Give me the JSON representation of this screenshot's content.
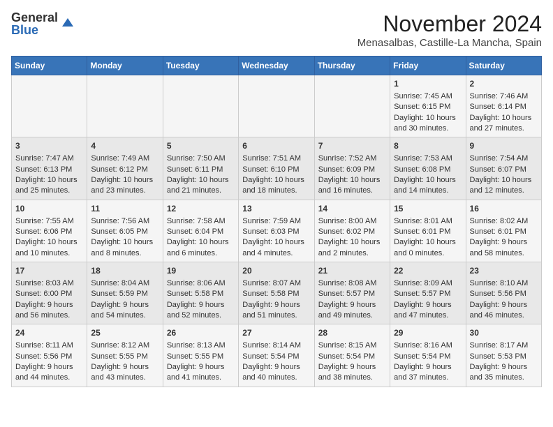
{
  "header": {
    "logo_line1": "General",
    "logo_line2": "Blue",
    "title": "November 2024",
    "subtitle": "Menasalbas, Castille-La Mancha, Spain"
  },
  "days_of_week": [
    "Sunday",
    "Monday",
    "Tuesday",
    "Wednesday",
    "Thursday",
    "Friday",
    "Saturday"
  ],
  "weeks": [
    [
      {
        "day": "",
        "info": ""
      },
      {
        "day": "",
        "info": ""
      },
      {
        "day": "",
        "info": ""
      },
      {
        "day": "",
        "info": ""
      },
      {
        "day": "",
        "info": ""
      },
      {
        "day": "1",
        "info": "Sunrise: 7:45 AM\nSunset: 6:15 PM\nDaylight: 10 hours and 30 minutes."
      },
      {
        "day": "2",
        "info": "Sunrise: 7:46 AM\nSunset: 6:14 PM\nDaylight: 10 hours and 27 minutes."
      }
    ],
    [
      {
        "day": "3",
        "info": "Sunrise: 7:47 AM\nSunset: 6:13 PM\nDaylight: 10 hours and 25 minutes."
      },
      {
        "day": "4",
        "info": "Sunrise: 7:49 AM\nSunset: 6:12 PM\nDaylight: 10 hours and 23 minutes."
      },
      {
        "day": "5",
        "info": "Sunrise: 7:50 AM\nSunset: 6:11 PM\nDaylight: 10 hours and 21 minutes."
      },
      {
        "day": "6",
        "info": "Sunrise: 7:51 AM\nSunset: 6:10 PM\nDaylight: 10 hours and 18 minutes."
      },
      {
        "day": "7",
        "info": "Sunrise: 7:52 AM\nSunset: 6:09 PM\nDaylight: 10 hours and 16 minutes."
      },
      {
        "day": "8",
        "info": "Sunrise: 7:53 AM\nSunset: 6:08 PM\nDaylight: 10 hours and 14 minutes."
      },
      {
        "day": "9",
        "info": "Sunrise: 7:54 AM\nSunset: 6:07 PM\nDaylight: 10 hours and 12 minutes."
      }
    ],
    [
      {
        "day": "10",
        "info": "Sunrise: 7:55 AM\nSunset: 6:06 PM\nDaylight: 10 hours and 10 minutes."
      },
      {
        "day": "11",
        "info": "Sunrise: 7:56 AM\nSunset: 6:05 PM\nDaylight: 10 hours and 8 minutes."
      },
      {
        "day": "12",
        "info": "Sunrise: 7:58 AM\nSunset: 6:04 PM\nDaylight: 10 hours and 6 minutes."
      },
      {
        "day": "13",
        "info": "Sunrise: 7:59 AM\nSunset: 6:03 PM\nDaylight: 10 hours and 4 minutes."
      },
      {
        "day": "14",
        "info": "Sunrise: 8:00 AM\nSunset: 6:02 PM\nDaylight: 10 hours and 2 minutes."
      },
      {
        "day": "15",
        "info": "Sunrise: 8:01 AM\nSunset: 6:01 PM\nDaylight: 10 hours and 0 minutes."
      },
      {
        "day": "16",
        "info": "Sunrise: 8:02 AM\nSunset: 6:01 PM\nDaylight: 9 hours and 58 minutes."
      }
    ],
    [
      {
        "day": "17",
        "info": "Sunrise: 8:03 AM\nSunset: 6:00 PM\nDaylight: 9 hours and 56 minutes."
      },
      {
        "day": "18",
        "info": "Sunrise: 8:04 AM\nSunset: 5:59 PM\nDaylight: 9 hours and 54 minutes."
      },
      {
        "day": "19",
        "info": "Sunrise: 8:06 AM\nSunset: 5:58 PM\nDaylight: 9 hours and 52 minutes."
      },
      {
        "day": "20",
        "info": "Sunrise: 8:07 AM\nSunset: 5:58 PM\nDaylight: 9 hours and 51 minutes."
      },
      {
        "day": "21",
        "info": "Sunrise: 8:08 AM\nSunset: 5:57 PM\nDaylight: 9 hours and 49 minutes."
      },
      {
        "day": "22",
        "info": "Sunrise: 8:09 AM\nSunset: 5:57 PM\nDaylight: 9 hours and 47 minutes."
      },
      {
        "day": "23",
        "info": "Sunrise: 8:10 AM\nSunset: 5:56 PM\nDaylight: 9 hours and 46 minutes."
      }
    ],
    [
      {
        "day": "24",
        "info": "Sunrise: 8:11 AM\nSunset: 5:56 PM\nDaylight: 9 hours and 44 minutes."
      },
      {
        "day": "25",
        "info": "Sunrise: 8:12 AM\nSunset: 5:55 PM\nDaylight: 9 hours and 43 minutes."
      },
      {
        "day": "26",
        "info": "Sunrise: 8:13 AM\nSunset: 5:55 PM\nDaylight: 9 hours and 41 minutes."
      },
      {
        "day": "27",
        "info": "Sunrise: 8:14 AM\nSunset: 5:54 PM\nDaylight: 9 hours and 40 minutes."
      },
      {
        "day": "28",
        "info": "Sunrise: 8:15 AM\nSunset: 5:54 PM\nDaylight: 9 hours and 38 minutes."
      },
      {
        "day": "29",
        "info": "Sunrise: 8:16 AM\nSunset: 5:54 PM\nDaylight: 9 hours and 37 minutes."
      },
      {
        "day": "30",
        "info": "Sunrise: 8:17 AM\nSunset: 5:53 PM\nDaylight: 9 hours and 35 minutes."
      }
    ]
  ]
}
